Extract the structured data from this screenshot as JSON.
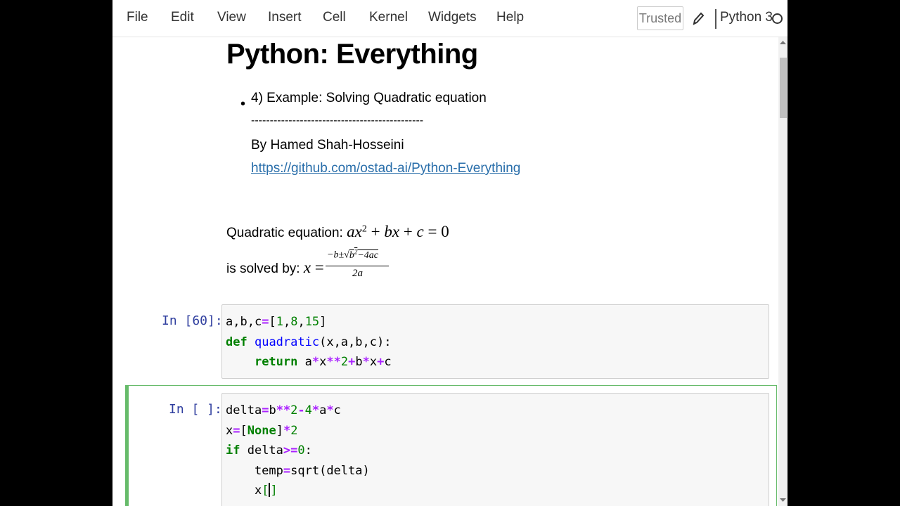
{
  "menubar": {
    "items": [
      "File",
      "Edit",
      "View",
      "Insert",
      "Cell",
      "Kernel",
      "Widgets",
      "Help"
    ],
    "trusted_label": "Trusted",
    "kernel_name": "Python 3",
    "pencil_icon": "pencil-icon",
    "kernel_indicator_icon": "circle-icon"
  },
  "markdown": {
    "title": "Python: Everything",
    "bullet": "4) Example: Solving Quadratic equation",
    "rule": "----------------------------------------------",
    "author": "By Hamed Shah-Hosseini",
    "link": "https://github.com/ostad-ai/Python-Everything",
    "eq_label": "Quadratic equation: ",
    "solved_label": "is solved by: "
  },
  "cells": [
    {
      "prompt": "In [60]:",
      "lines": [
        "a,b,c=[1,8,15]",
        "def quadratic(x,a,b,c):",
        "    return a*x**2+b*x+c"
      ]
    },
    {
      "prompt": "In [ ]:",
      "lines": [
        "delta=b**2-4*a*c",
        "x=[None]*2",
        "if delta>=0:",
        "    temp=sqrt(delta)",
        "    x[]"
      ]
    }
  ],
  "colors": {
    "selected_cell_border": "#66bb6a",
    "prompt": "#303f9f",
    "link": "#296eaa",
    "keyword": "#008000",
    "operator": "#aa22ff"
  }
}
